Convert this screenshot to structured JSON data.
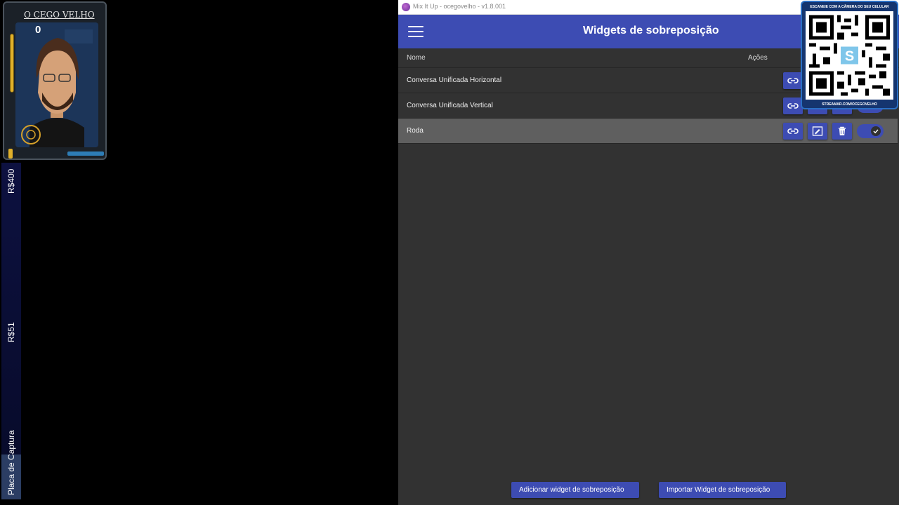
{
  "overlay": {
    "streamer_name": "O CEGO VELHO",
    "counter": "0",
    "side_labels": [
      "R$400",
      "R$51",
      "Placa de Captura"
    ]
  },
  "window": {
    "title": "Mix It Up - ocegovelho - v1.8.001",
    "page_title": "Widgets de sobreposição",
    "columns": {
      "name": "Nome",
      "actions": "Ações"
    },
    "rows": [
      {
        "name": "Conversa Unificada Horizontal",
        "enabled": true
      },
      {
        "name": "Conversa Unificada Vertical",
        "enabled": true
      },
      {
        "name": "Roda",
        "enabled": true,
        "selected": true
      }
    ],
    "buttons": {
      "add": "Adicionar widget de sobreposição",
      "import": "Importar Widget de sobreposição"
    },
    "icons": [
      "menu-icon",
      "link-icon",
      "edit-icon",
      "delete-icon",
      "check-icon"
    ],
    "accent_color": "#3d4cb3",
    "background_color": "#323232"
  },
  "qr": {
    "top_text": "ESCANEIE COM A CÂMERA DO SEU CELULAR",
    "bottom_text": "STREAMAR.COM/OCEGOVELHO",
    "logo_letter": "S"
  }
}
